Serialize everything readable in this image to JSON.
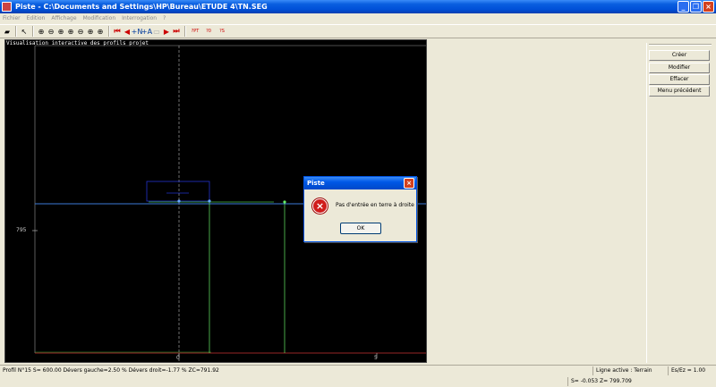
{
  "window": {
    "title": "Piste - C:\\Documents and Settings\\HP\\Bureau\\ETUDE 4\\TN.SEG"
  },
  "menu": [
    "Fichier",
    "Edition",
    "Affichage",
    "Modification",
    "Interrogation",
    "?"
  ],
  "toolbar": {
    "icons": [
      "open-folder-icon",
      "pointer-icon",
      "zoom-window-icon",
      "zoom-out-icon",
      "zoom-in-icon",
      "zoom-extents-icon",
      "zoom-previous-icon",
      "zoom-all-icon",
      "zoom-detail-icon",
      "first-profile-icon",
      "previous-profile-icon",
      "profile-up-icon",
      "profile-down-icon",
      "next-profile-icon",
      "last-profile-icon",
      "show-pt-icon",
      "show-pd-icon",
      "show-ps-icon"
    ],
    "labels": {
      "prev_up": "+N",
      "prev_down": "+A",
      "pt": "?PT",
      "p0": "?0",
      "ps": "?S"
    }
  },
  "canvas": {
    "title": "Visualisation interactive des profils projet",
    "y_label": "795",
    "x_labels": [
      "0",
      "5"
    ]
  },
  "right_panel": {
    "buttons": [
      "Créer",
      "Modifier",
      "Effacer",
      "Menu précédent"
    ]
  },
  "dialog": {
    "title": "Piste",
    "message": "Pas d'entrée en terre à droite",
    "ok_label": "OK"
  },
  "status": {
    "profile_info": "Profil N°15 S= 600.00 Dévers gauche=2.50 % Dévers droit=-1.77 % ZC=791.92",
    "active_line": "Ligne active : Terrain",
    "scale": "Es/Ez = 1.00",
    "coords": "S= -0.053  Z= 799.709"
  },
  "colors": {
    "titlebar": "#0050d8",
    "error_icon": "#d01c1c"
  }
}
